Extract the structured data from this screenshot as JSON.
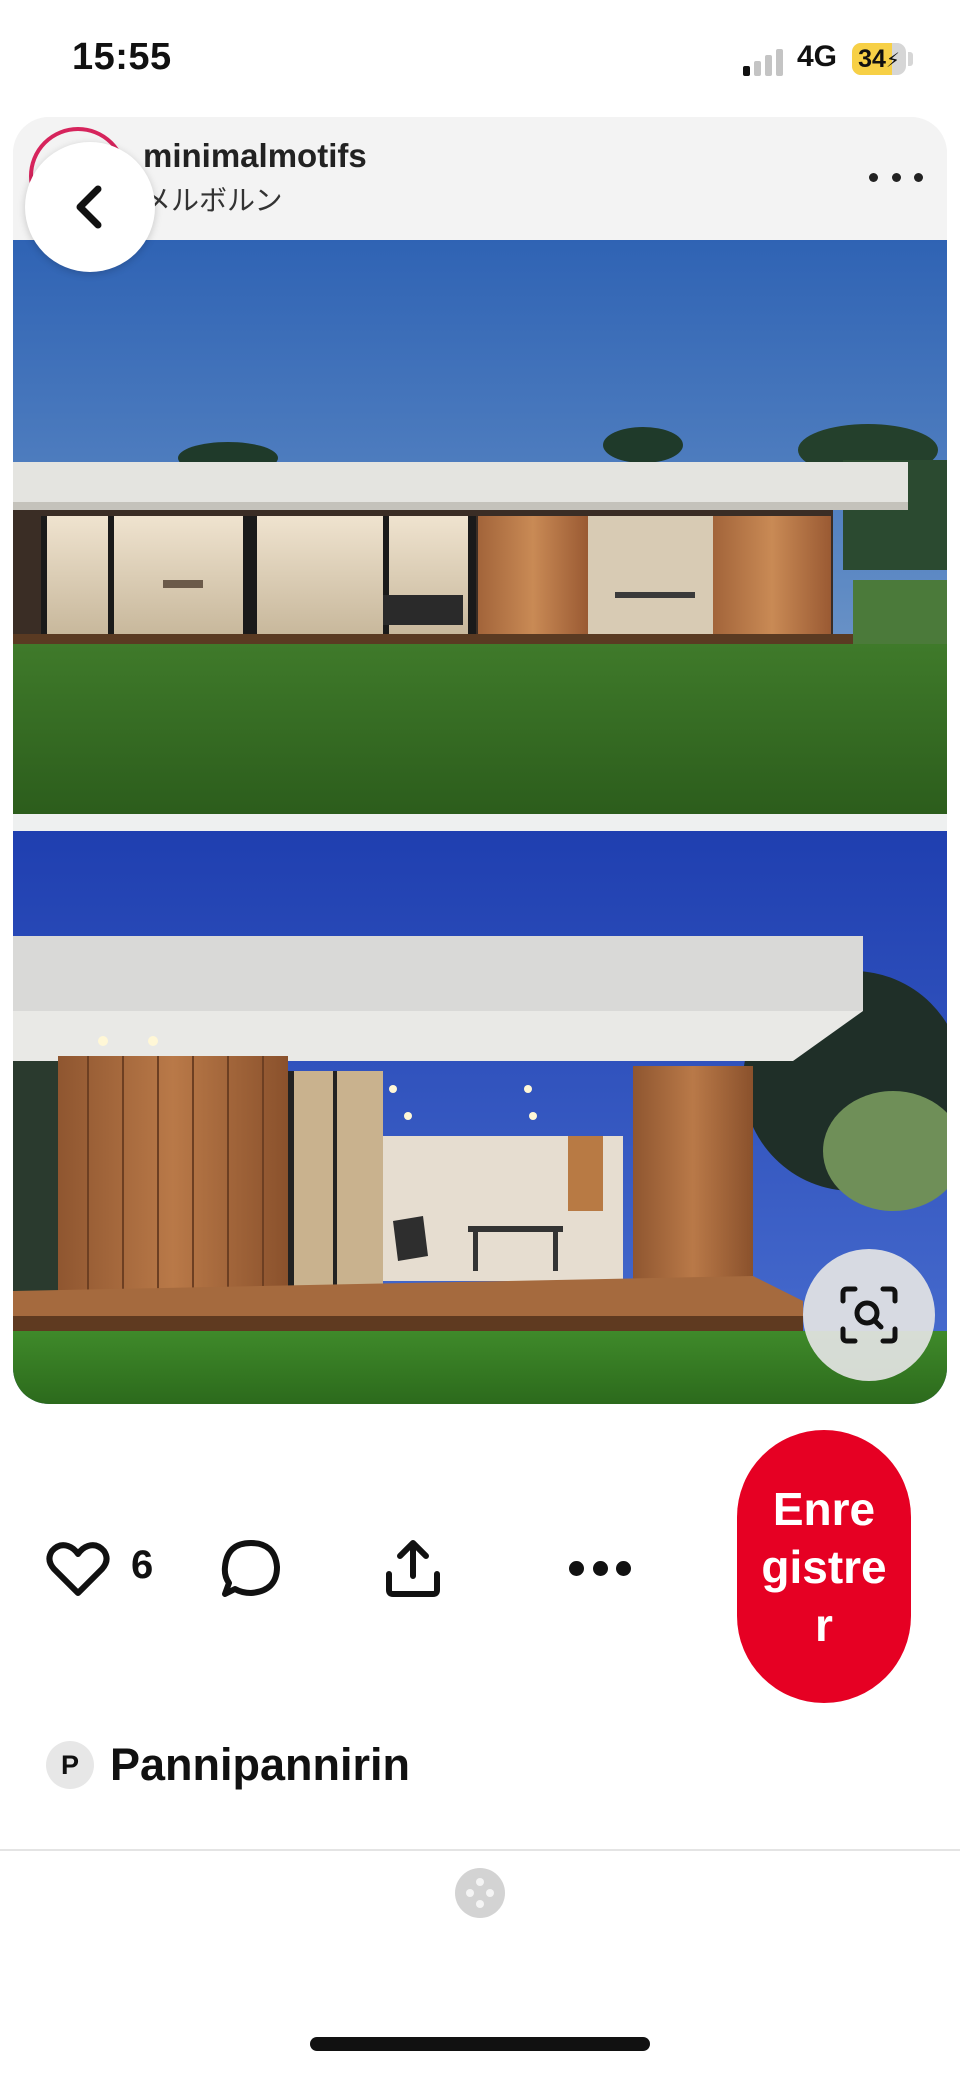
{
  "status_bar": {
    "time": "15:55",
    "network": "4G",
    "battery": "34",
    "battery_level_percent": 34
  },
  "pin": {
    "account_name": "minimalmotifs",
    "location": "メルボルン",
    "images": [
      {
        "icon": "photo-house-dusk-lawn"
      },
      {
        "icon": "photo-house-covered-deck"
      }
    ],
    "visual_search_icon": "lens-search-icon"
  },
  "actions": {
    "like_count": "6",
    "save_label": "Enregistrer",
    "accent_color": "#e60023"
  },
  "board": {
    "avatar_letter": "P",
    "name": "Pannipannirin"
  },
  "icons": {
    "back": "chevron-left-icon",
    "more": "ellipsis-icon",
    "like": "heart-icon",
    "comment": "speech-bubble-icon",
    "share": "upload-icon"
  }
}
